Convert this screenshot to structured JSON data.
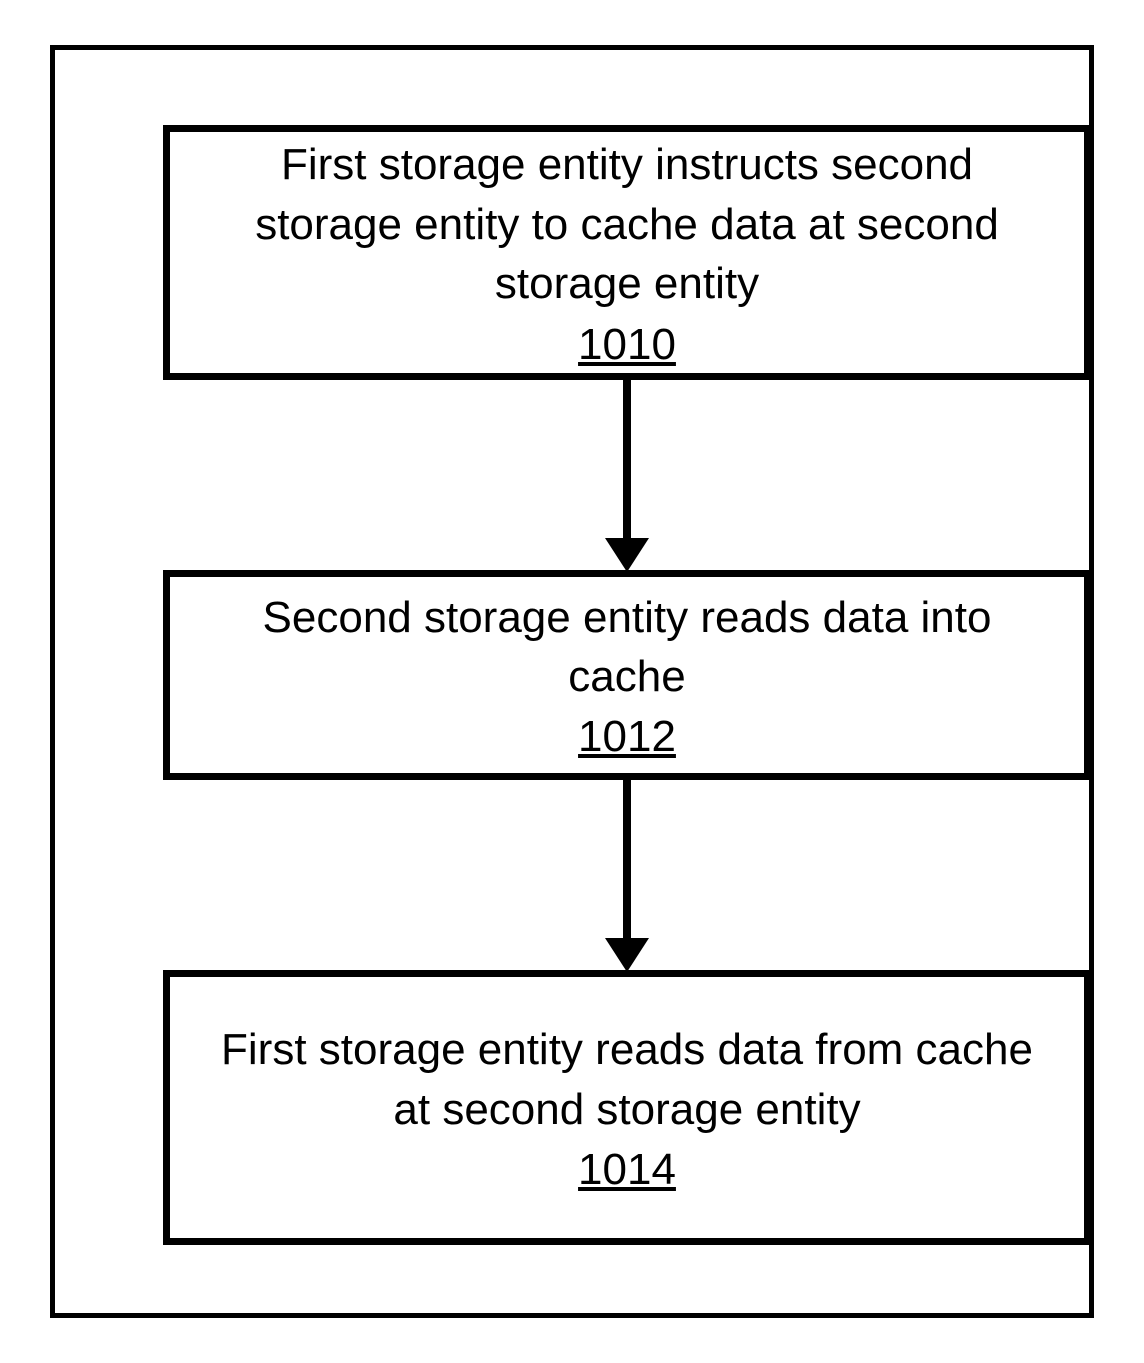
{
  "diagram": {
    "steps": [
      {
        "text": "First storage entity instructs second storage entity to cache data at second storage entity",
        "ref": "1010"
      },
      {
        "text": "Second storage entity reads data into cache",
        "ref": "1012"
      },
      {
        "text": "First storage entity reads data from cache at second storage entity",
        "ref": "1014"
      }
    ]
  }
}
